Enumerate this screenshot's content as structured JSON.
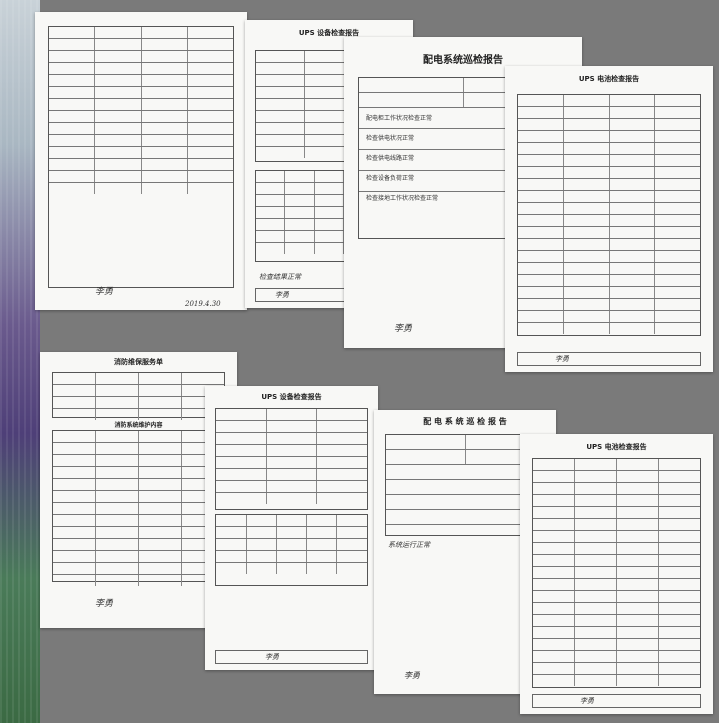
{
  "documents": {
    "fire_form_top": {
      "title": "",
      "signature": "李勇",
      "footer_value": "2019.4.30"
    },
    "ups_top": {
      "title": "UPS 设备检查报告",
      "note": "检查结果正常",
      "sign": "李勇"
    },
    "power_top": {
      "title": "配电系统巡检报告",
      "rows": [
        "配电柜工作状况检查正常",
        "检查供电状况正常",
        "检查供电线路正常",
        "检查设备负荷正常",
        "检查接地工作状况检查正常"
      ],
      "sign": "李勇"
    },
    "battery_top": {
      "title": "UPS 电池检查报告",
      "sign": "李勇"
    },
    "fire_form_bottom": {
      "title": "消防维保服务单",
      "subtitle": "消防系统维护内容",
      "signature": "李勇"
    },
    "ups_bottom": {
      "title": "UPS 设备检查报告",
      "sign": "李勇"
    },
    "power_bottom": {
      "title": "配 电 系 统 巡 检 报 告",
      "note": "系统运行正常",
      "sign": "李勇"
    },
    "battery_bottom": {
      "title": "UPS 电池检查报告",
      "sign": "李勇"
    }
  }
}
